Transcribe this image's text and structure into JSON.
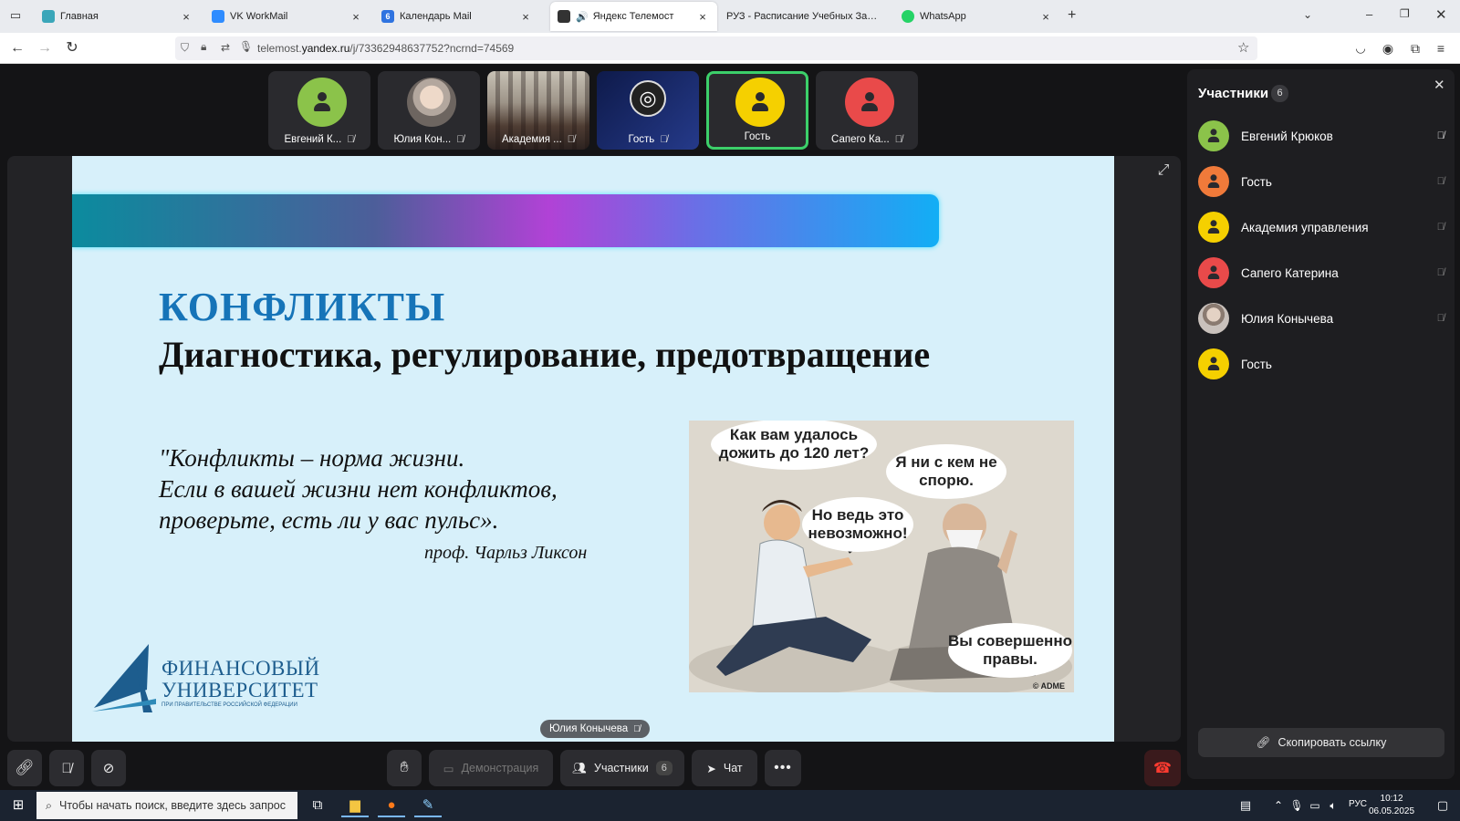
{
  "browser": {
    "tabs": [
      {
        "title": "Главная",
        "favicon_color": "#3aa6b9",
        "active": false
      },
      {
        "title": "VK WorkMail",
        "favicon_color": "#2f8cff",
        "active": false
      },
      {
        "title": "Календарь Mail",
        "favicon_color": "#2f73e0",
        "active": false
      },
      {
        "title": "Яндекс Телемост",
        "favicon_color": "#333333",
        "active": true
      },
      {
        "title": "РУЗ - Расписание Учебных Занятий",
        "favicon_color": "#ffffff",
        "active": false
      },
      {
        "title": "WhatsApp",
        "favicon_color": "#25d366",
        "active": false
      }
    ],
    "url_prefix": "telemost.",
    "url_domain": "yandex.ru",
    "url_path": "/j/73362948637752?ncrnd=74569"
  },
  "tiles": [
    {
      "name": "Евгений К...",
      "avatar_color": "#8bc34a",
      "type": "avatar"
    },
    {
      "name": "Юлия Кон...",
      "type": "photo"
    },
    {
      "name": "Академия ...",
      "type": "room"
    },
    {
      "name": "Гость",
      "type": "obs"
    },
    {
      "name": "Гость",
      "avatar_color": "#f5d000",
      "type": "avatar",
      "speaking": true
    },
    {
      "name": "Сапего Ка...",
      "avatar_color": "#e94a4a",
      "type": "avatar"
    }
  ],
  "slide": {
    "title": "КОНФЛИКТЫ",
    "subtitle": "Диагностика, регулирование, предотвращение",
    "quote_lines": [
      "\"Конфликты – норма жизни.",
      "Если в вашей жизни нет конфликтов,",
      "проверьте, есть ли у вас пульс»."
    ],
    "quote_author": "проф. Чарльз Ликсон",
    "logo_line1": "ФИНАНСОВЫЙ",
    "logo_line2": "УНИВЕРСИТЕТ",
    "logo_line3": "ПРИ ПРАВИТЕЛЬСТВЕ РОССИЙСКОЙ ФЕДЕРАЦИИ",
    "comic": {
      "bubble1": "Как вам удалось дожить до 120 лет?",
      "bubble2": "Я ни с кем не спорю.",
      "bubble3": "Но ведь это невозможно!",
      "bubble4": "Вы совершенно правы.",
      "copyright": "© ADME"
    }
  },
  "speaker_label": "Юлия Конычева",
  "controls": {
    "demo_label": "Демонстрация",
    "participants_label": "Участники",
    "participants_count": "6",
    "chat_label": "Чат"
  },
  "panel": {
    "title": "Участники",
    "count": "6",
    "participants": [
      {
        "name": "Евгений Крюков",
        "color": "#8bc34a",
        "mic_on": true
      },
      {
        "name": "Гость",
        "color": "#f07a3a",
        "mic_on": false
      },
      {
        "name": "Академия управления",
        "color": "#f5d000",
        "mic_on": false
      },
      {
        "name": "Сапего Катерина",
        "color": "#e94a4a",
        "mic_on": false
      },
      {
        "name": "Юлия Конычева",
        "photo": true,
        "mic_on": false
      },
      {
        "name": "Гость",
        "color": "#f5d000",
        "no_mic": true
      }
    ],
    "copy_link_label": "Скопировать ссылку"
  },
  "taskbar": {
    "search_placeholder": "Чтобы начать поиск, введите здесь запрос",
    "lang": "РУС",
    "time": "10:12",
    "date": "06.05.2025"
  }
}
